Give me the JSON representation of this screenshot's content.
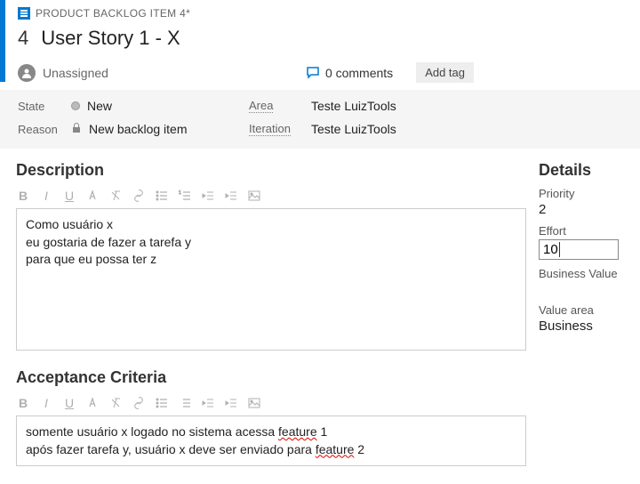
{
  "header": {
    "type_label": "PRODUCT BACKLOG ITEM 4*",
    "id": "4",
    "title": "User Story 1 - X",
    "assignee": "Unassigned",
    "comments_count": "0 comments",
    "add_tag_label": "Add tag"
  },
  "fields": {
    "state_label": "State",
    "state_value": "New",
    "reason_label": "Reason",
    "reason_value": "New backlog item",
    "area_label": "Area",
    "area_value": "Teste LuizTools",
    "iteration_label": "Iteration",
    "iteration_value": "Teste LuizTools"
  },
  "description": {
    "title": "Description",
    "line1": "Como usuário x",
    "line2": "eu gostaria de fazer a tarefa y",
    "line3": "para que eu possa ter z"
  },
  "acceptance": {
    "title": "Acceptance Criteria",
    "l1a": "somente usuário x logado no sistema acessa ",
    "l1b": "feature",
    "l1c": " 1",
    "l2a": "após fazer tarefa y, usuário x deve ser enviado para ",
    "l2b": "feature",
    "l2c": " 2"
  },
  "details": {
    "title": "Details",
    "priority_label": "Priority",
    "priority_value": "2",
    "effort_label": "Effort",
    "effort_value": "10",
    "bv_label": "Business Value",
    "va_label": "Value area",
    "va_value": "Business"
  },
  "toolbar": {
    "b": "B",
    "i": "I",
    "u": "U"
  }
}
